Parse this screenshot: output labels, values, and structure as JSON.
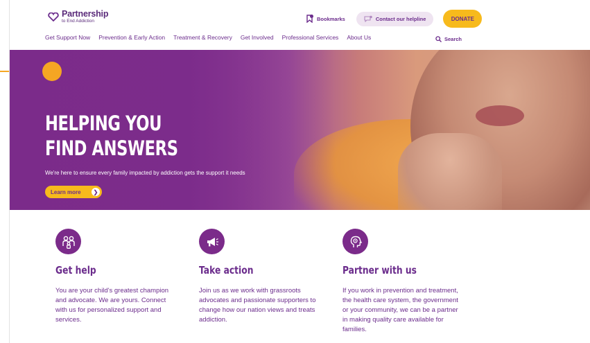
{
  "header": {
    "logo": {
      "main": "Partnership",
      "sub": "to End Addiction"
    },
    "bookmarks": "Bookmarks",
    "helpline": "Contact our helpline",
    "donate": "DONATE",
    "search": "Search"
  },
  "nav": {
    "items": [
      "Get Support Now",
      "Prevention & Early Action",
      "Treatment & Recovery",
      "Get Involved",
      "Professional Services",
      "About Us"
    ]
  },
  "hero": {
    "title_line1": "HELPING YOU",
    "title_line2": "FIND ANSWERS",
    "subtitle": "We're here to ensure every family impacted by addiction gets the support it needs",
    "cta": "Learn more",
    "cta_icon": "chevron-right-icon"
  },
  "cards": [
    {
      "icon": "family-icon",
      "title": "Get help",
      "body": "You are your child's greatest champion and advocate. We are yours. Connect with us for personalized support and services."
    },
    {
      "icon": "megaphone-icon",
      "title": "Take action",
      "body": "Join us as we work with grassroots advocates and passionate supporters to change how our nation views and treats addiction."
    },
    {
      "icon": "head-profile-icon",
      "title": "Partner with us",
      "body": "If you work in prevention and treatment, the health care system, the government or your community, we can be a partner in making quality care available for families."
    }
  ],
  "colors": {
    "brand_purple": "#7b2b8a",
    "accent_yellow": "#f7ba1c",
    "callout_orange": "#f5a623"
  }
}
